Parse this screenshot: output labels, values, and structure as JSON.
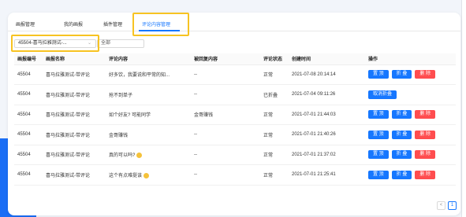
{
  "tabs": [
    {
      "label": "画报管理",
      "active": false
    },
    {
      "label": "我的画报",
      "active": false
    },
    {
      "label": "插件管理",
      "active": false
    },
    {
      "label": "评论内容管理",
      "active": true
    }
  ],
  "filters": {
    "poster_select_value": "45504-喜马拉雅测试-...",
    "status_select_value": "全部"
  },
  "table": {
    "headers": [
      "画报编号",
      "画报名称",
      "评论内容",
      "被回复内容",
      "评论状态",
      "创建时间",
      "操作"
    ],
    "rows": [
      {
        "id": "45504",
        "name": "喜马拉雅测试-带评论",
        "content": "好多饮，我要说和平常的知...",
        "reply": "--",
        "status": "正常",
        "time": "2021-07-08 20:14:14",
        "actions": [
          "置 顶",
          "折 叠",
          "删 除"
        ],
        "emoji": false
      },
      {
        "id": "45504",
        "name": "喜马拉雅测试-带评论",
        "content": "抢不到单子",
        "reply": "--",
        "status": "已折叠",
        "time": "2021-07-04 09:11:26",
        "actions": [
          "取消折叠"
        ],
        "emoji": false
      },
      {
        "id": "45504",
        "name": "喜马拉雅测试-带评论",
        "content": "如个好友? 可能同学",
        "reply": "金哥赚钱",
        "status": "正常",
        "time": "2021-07-01 21:44:03",
        "actions": [
          "置 顶",
          "折 叠",
          "删 除"
        ],
        "emoji": false
      },
      {
        "id": "45504",
        "name": "喜马拉雅测试-带评论",
        "content": "金哥赚钱",
        "reply": "--",
        "status": "正常",
        "time": "2021-07-01 21:40:26",
        "actions": [
          "置 顶",
          "折 叠",
          "删 除"
        ],
        "emoji": false
      },
      {
        "id": "45504",
        "name": "喜马拉雅测试-带评论",
        "content": "真的可以吗?",
        "reply": "--",
        "status": "正常",
        "time": "2021-07-01 21:37:02",
        "actions": [
          "置 顶",
          "折 叠",
          "删 除"
        ],
        "emoji": true
      },
      {
        "id": "45504",
        "name": "喜马拉雅测试-带评论",
        "content": "这个有点难挺该",
        "reply": "--",
        "status": "正常",
        "time": "2021-07-01 21:25:41",
        "actions": [
          "置 顶",
          "折 叠",
          "删 除"
        ],
        "emoji": true
      }
    ]
  },
  "pagination": {
    "prev": "<",
    "current": "1"
  },
  "colors": {
    "accent": "#1677ff",
    "danger": "#ff4d4f",
    "highlight": "#f7c322",
    "deco": "#1a6ef5"
  }
}
